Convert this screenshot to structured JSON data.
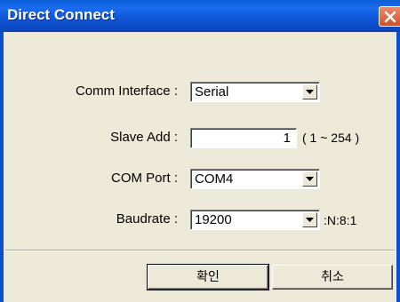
{
  "window": {
    "title": "Direct Connect"
  },
  "form": {
    "comm_interface": {
      "label": "Comm Interface :",
      "value": "Serial"
    },
    "slave_add": {
      "label": "Slave Add :",
      "value": "1",
      "range_hint": "( 1 ~ 254 )"
    },
    "com_port": {
      "label": "COM Port :",
      "value": "COM4"
    },
    "baudrate": {
      "label": "Baudrate :",
      "value": "19200",
      "suffix": ":N:8:1"
    }
  },
  "buttons": {
    "ok_label": "확인",
    "cancel_label": "취소"
  },
  "icons": {
    "close": "close-icon",
    "dropdown": "chevron-down-icon"
  },
  "colors": {
    "titlebar": "#0a5fd8",
    "close": "#d24f2b",
    "background": "#ece9d8"
  }
}
